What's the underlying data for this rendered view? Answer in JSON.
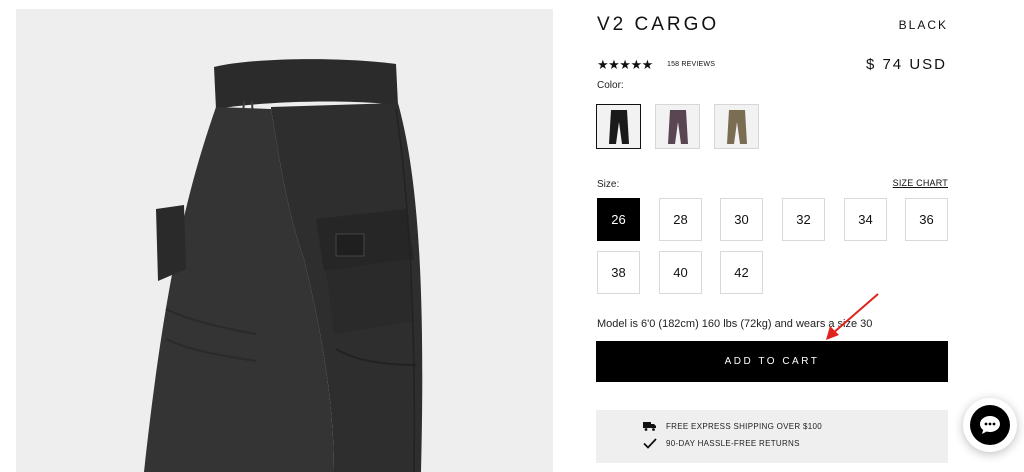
{
  "product": {
    "title": "V2 CARGO",
    "color_name": "BLACK",
    "stars": "★★★★★",
    "reviews": "158 REVIEWS",
    "price": "$ 74 USD"
  },
  "color_section": {
    "label": "Color:",
    "swatches": [
      {
        "name": "black",
        "color": "#1a1a1a",
        "selected": true
      },
      {
        "name": "purple",
        "color": "#5a4552",
        "selected": false
      },
      {
        "name": "olive",
        "color": "#7a6d52",
        "selected": false
      }
    ]
  },
  "size_section": {
    "label": "Size:",
    "size_chart_label": "SIZE CHART",
    "sizes": [
      "26",
      "28",
      "30",
      "32",
      "34",
      "36",
      "38",
      "40",
      "42"
    ],
    "selected": "26"
  },
  "model_note": "Model is 6'0 (182cm) 160 lbs (72kg) and wears a size 30",
  "add_to_cart_label": "ADD TO CART",
  "info": {
    "shipping": "FREE EXPRESS SHIPPING OVER $100",
    "returns": "90-DAY HASSLE-FREE RETURNS"
  },
  "icons": {
    "shipping": "truck-icon",
    "returns": "checkmark-icon",
    "chat": "chat-icon"
  },
  "colors": {
    "annotation_arrow": "#e0231b",
    "button_bg": "#000000",
    "info_bg": "#efefef"
  }
}
